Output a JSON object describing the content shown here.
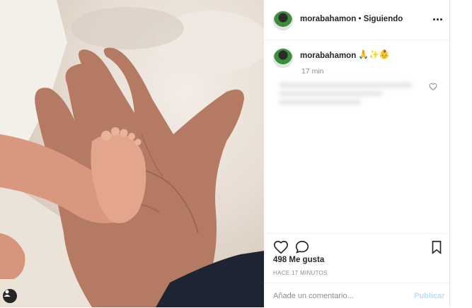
{
  "post": {
    "username": "morabahamon",
    "separator": "•",
    "follow_status": "Siguiendo",
    "caption_emojis": "🙏✨👶",
    "time_short": "17 min",
    "likes": "498 Me gusta",
    "time_ago": "HACE 17 MINUTOS"
  },
  "comment": {
    "placeholder": "Añade un comentario...",
    "publish_label": "Publicar"
  },
  "icons": {
    "more": "more-options-icon",
    "like": "heart-icon",
    "comment": "comment-icon",
    "save": "bookmark-icon",
    "user_tag": "user-tag-icon"
  },
  "colors": {
    "accent": "#b2dffc",
    "text": "#262626",
    "muted": "#8e8e8e"
  }
}
